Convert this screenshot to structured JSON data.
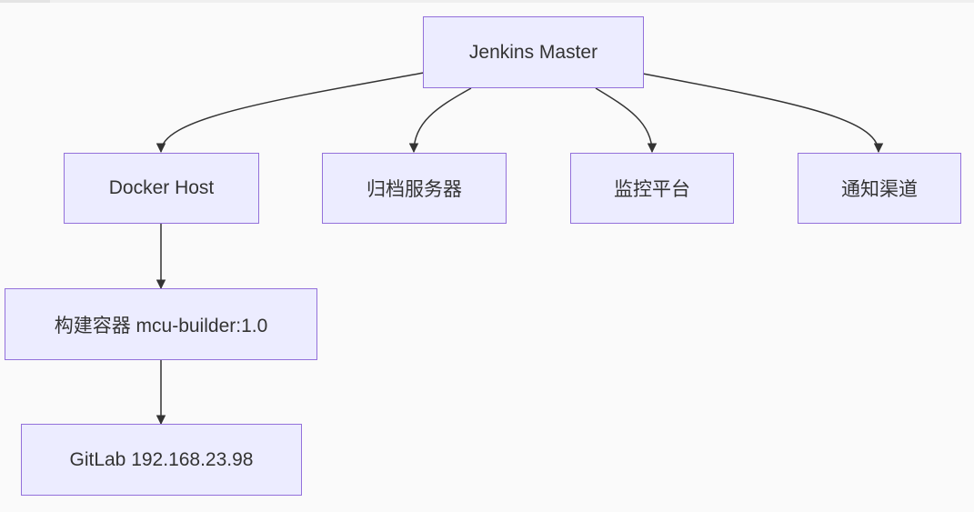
{
  "diagram": {
    "nodes": {
      "jenkins": "Jenkins Master",
      "docker": "Docker Host",
      "archive": "归档服务器",
      "monitor": "监控平台",
      "notify": "通知渠道",
      "builder": "构建容器 mcu-builder:1.0",
      "gitlab": "GitLab 192.168.23.98"
    },
    "colors": {
      "node_fill": "#ececff",
      "node_border": "#9370db",
      "edge": "#333333",
      "text": "#333333",
      "background": "#fafafa"
    }
  }
}
